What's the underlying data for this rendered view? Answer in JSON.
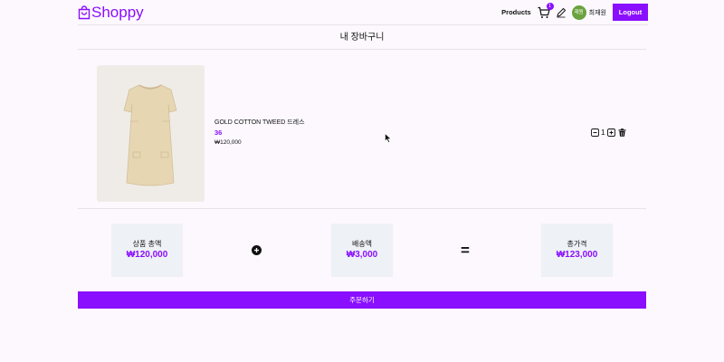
{
  "header": {
    "logo_text": "Shoppy",
    "nav_products": "Products",
    "cart_count": "1",
    "avatar_text": "재원",
    "username": "최재원",
    "logout_label": "Logout"
  },
  "page": {
    "title": "내 장바구니"
  },
  "cart": {
    "items": [
      {
        "name": "GOLD COTTON TWEED 드레스",
        "size": "36",
        "price": "₩120,000",
        "quantity": "1"
      }
    ]
  },
  "summary": {
    "subtotal_label": "상품 총액",
    "subtotal_value": "₩120,000",
    "shipping_label": "배송액",
    "shipping_value": "₩3,000",
    "total_label": "총가격",
    "total_value": "₩123,000"
  },
  "order_button_label": "주문하기",
  "colors": {
    "accent": "#8a0fff",
    "avatar_bg": "#6ba23d",
    "box_bg": "#eef1f5"
  },
  "icons": [
    "shopping-bag-icon",
    "cart-icon",
    "pencil-icon",
    "minus-square-icon",
    "plus-square-icon",
    "trash-icon",
    "plus-circle-icon",
    "equals-icon"
  ]
}
